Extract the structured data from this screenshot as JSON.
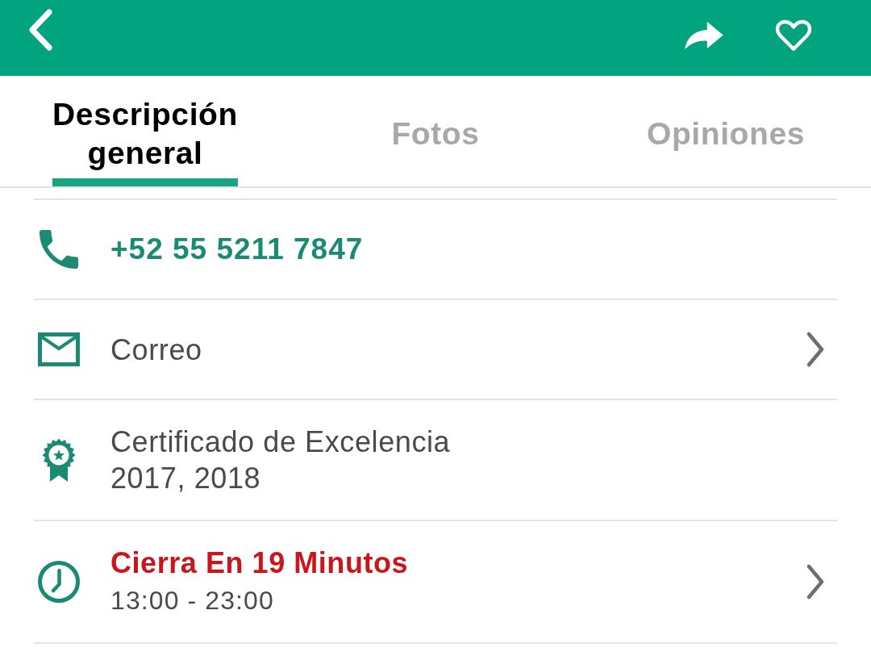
{
  "top_bar": {
    "favorited": false
  },
  "tabs": [
    {
      "label": "Descripción general",
      "selected": true
    },
    {
      "label": "Fotos",
      "selected": false
    },
    {
      "label": "Opiniones",
      "selected": false
    }
  ],
  "details": [
    {
      "kind": "phone",
      "text": "+52 55 5211 7847",
      "chevron": false
    },
    {
      "kind": "email",
      "text": "Correo",
      "chevron": true
    },
    {
      "kind": "award",
      "text": "Certificado de Excelencia",
      "detail": "2017, 2018",
      "chevron": false
    },
    {
      "kind": "hours",
      "text": "Cierra En 19 Minutos",
      "detail": "13:00 - 23:00",
      "chevron": true
    }
  ]
}
